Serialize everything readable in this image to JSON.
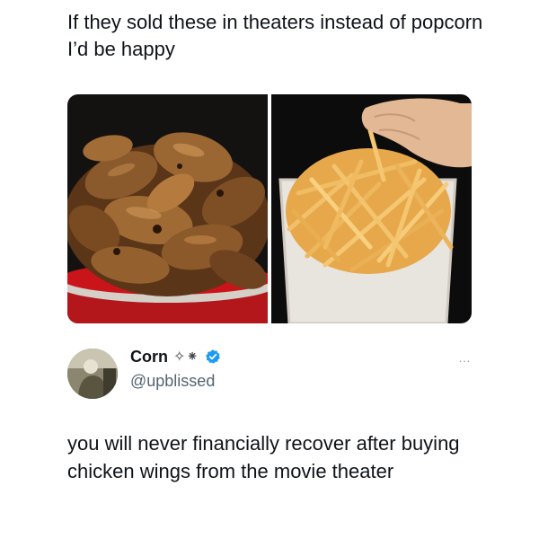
{
  "post": {
    "caption": "If they sold these in theaters instead of popcorn I’d be happy"
  },
  "media": {
    "left_image": "chicken-wings-bucket",
    "right_image": "french-fries-bucket"
  },
  "tweet": {
    "display_name": "Corn",
    "name_emoji": "✧⁕",
    "verified": true,
    "handle": "@upblissed",
    "text": "you will never financially recover after buying chicken wings from the movie theater",
    "more_icon": "…"
  },
  "colors": {
    "text": "#0f1419",
    "muted": "#536471",
    "verified_blue": "#1d9bf0"
  }
}
